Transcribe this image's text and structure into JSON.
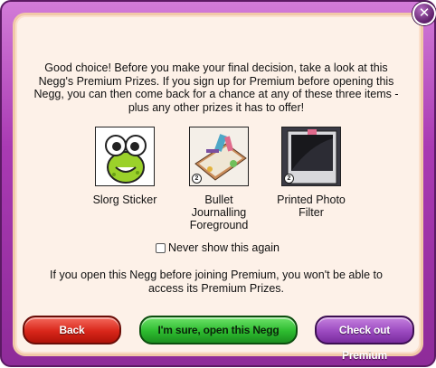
{
  "dialog": {
    "close_glyph": "✕",
    "message": "Good choice! Before you make your final decision, take a look at this Negg's Premium Prizes. If you sign up for Premium before opening this Negg, you can then come back for a chance at any of these three items - plus any other prizes it has to offer!",
    "prizes": [
      {
        "label": "Slorg Sticker",
        "icon": "slorg-sticker-image"
      },
      {
        "label": "Bullet Journalling Foreground",
        "icon": "bullet-journal-image"
      },
      {
        "label": "Printed Photo Filter",
        "icon": "photo-filter-image"
      }
    ],
    "never_show_label": "Never show this again",
    "warning": "If you open this Negg before joining Premium, you won't be able to access its Premium Prizes.",
    "buttons": {
      "back": "Back",
      "open": "I'm sure, open this Negg",
      "premium": "Check out Premium"
    }
  }
}
